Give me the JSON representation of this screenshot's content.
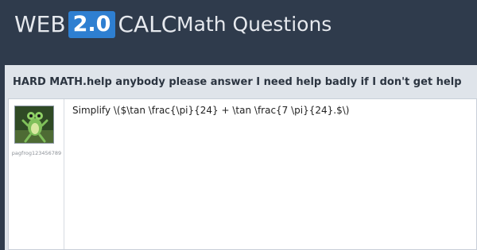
{
  "header": {
    "logo_web": "WEB",
    "logo_version": "2.0",
    "logo_calc": "CALC",
    "section": "Math Questions"
  },
  "question": {
    "title": "HARD MATH.help anybody please answer I need help badly if I don't get help",
    "poster": "pagfrog123456789",
    "avatar_icon": "frog-icon",
    "content": "Simplify \\($\\tan \\frac{\\pi}{24} + \\tan \\frac{7 \\pi}{24}.$\\)"
  },
  "colors": {
    "page_bg": "#2f3b4c",
    "logo_accent": "#2e7fd1",
    "card_bg": "#dfe4ea"
  }
}
